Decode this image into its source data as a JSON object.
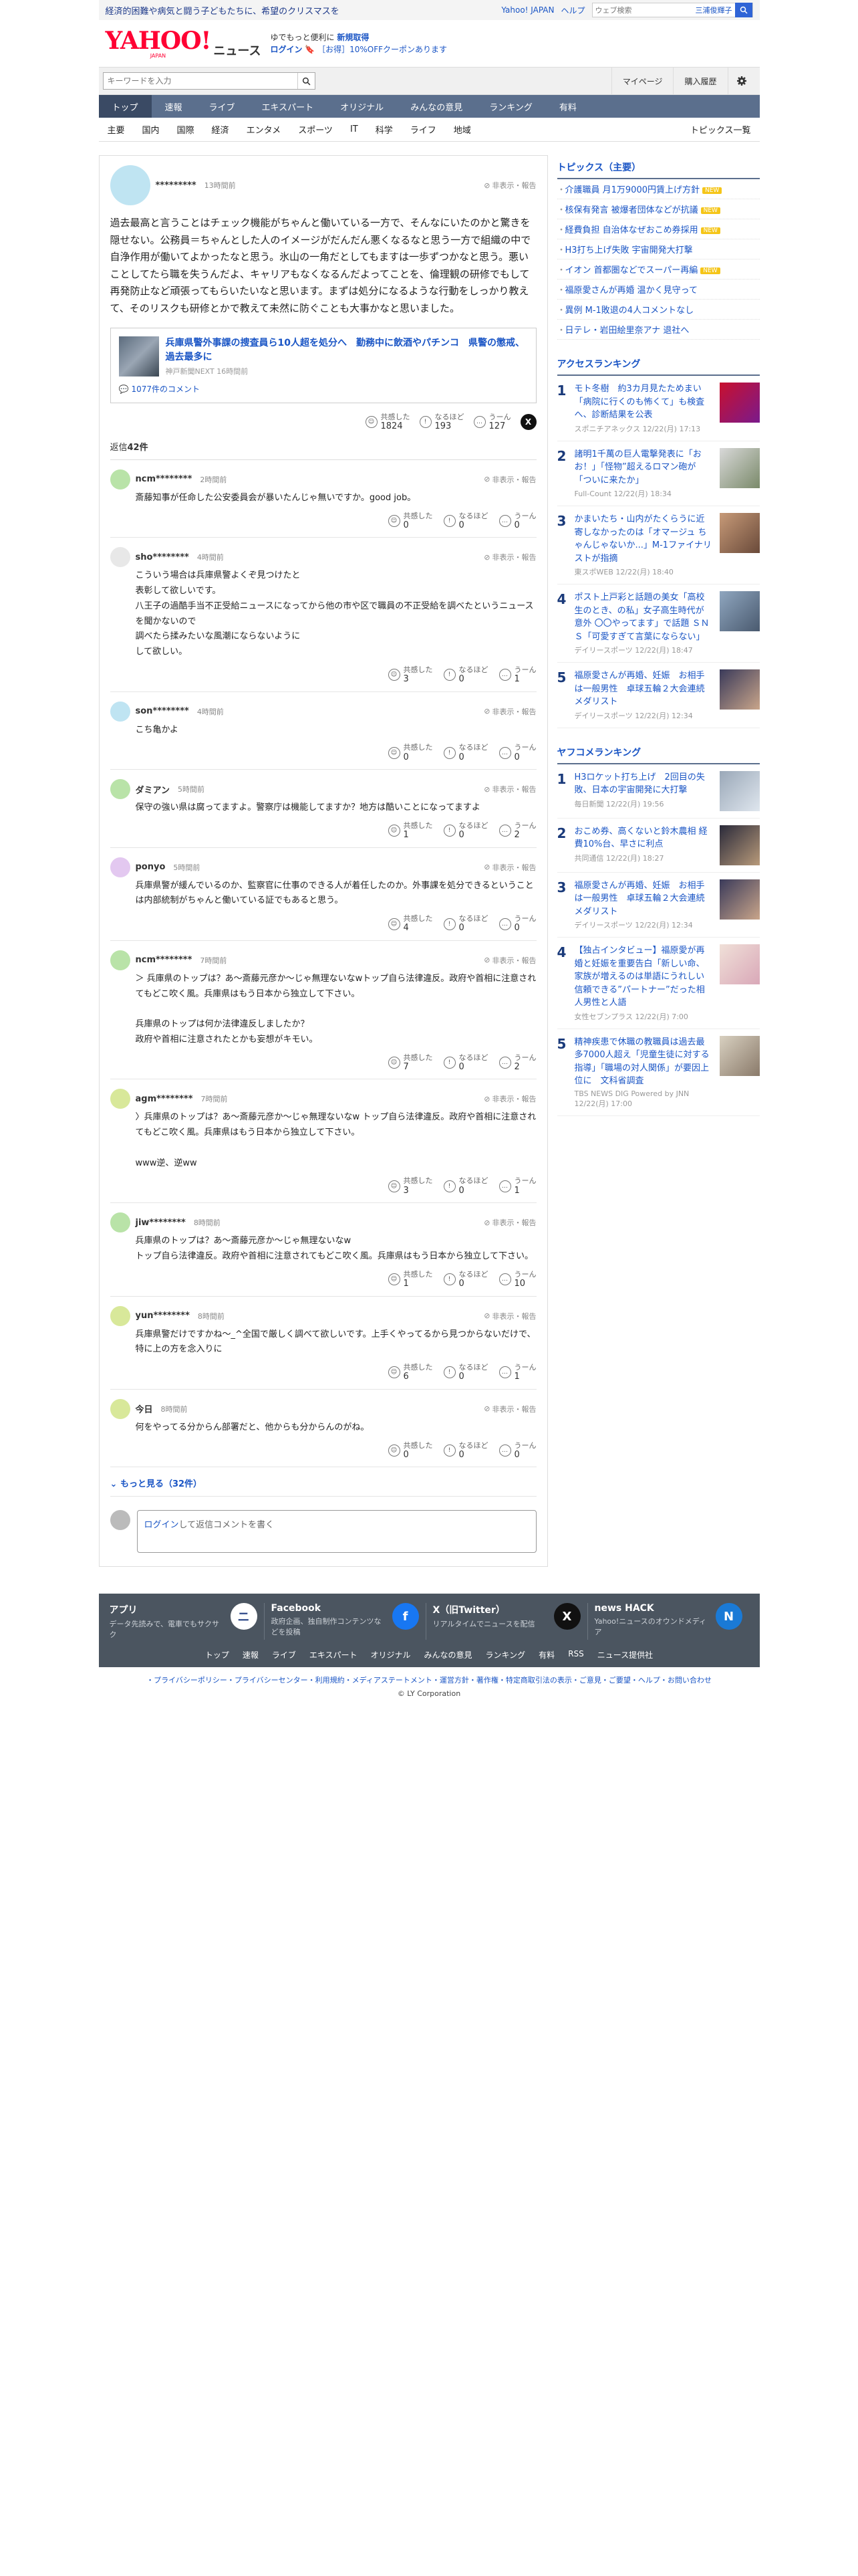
{
  "top_strip": {
    "promo": "経済的困難や病気と闘う子どもたちに、希望のクリスマスを",
    "yahoo_japan": "Yahoo! JAPAN",
    "help": "ヘルプ",
    "search_placeholder": "ウェブ検索",
    "search_hint": "三浦俊輝子"
  },
  "header": {
    "logo_text": "YAHOO!",
    "logo_sub": "JAPAN",
    "logo_news": "ニュース",
    "msg_line1_prefix": "ゆでもっと便利に",
    "msg_line1_link": "新規取得",
    "msg_line2_login": "ログイン",
    "msg_line2_rest": "［お得］10%OFFクーポンあります"
  },
  "search": {
    "placeholder": "キーワードを入力",
    "mypage": "マイページ",
    "history": "購入履歴"
  },
  "nav_main": [
    "トップ",
    "速報",
    "ライブ",
    "エキスパート",
    "オリジナル",
    "みんなの意見",
    "ランキング",
    "有料"
  ],
  "nav_sub": [
    "主要",
    "国内",
    "国際",
    "経済",
    "エンタメ",
    "スポーツ",
    "IT",
    "科学",
    "ライフ",
    "地域"
  ],
  "nav_sub_right": "トピックス一覧",
  "root_comment": {
    "user": "*********",
    "time": "13時間前",
    "report": "非表示・報告",
    "body": "過去最高と言うことはチェック機能がちゃんと働いている一方で、そんなにいたのかと驚きを隠せない。公務員＝ちゃんとした人のイメージがだんだん悪くなるなと思う一方で組織の中で自浄作用が働いてよかったなと思う。氷山の一角だとしてもますは一歩ずつかなと思う。悪いことしてたら職を失うんだよ、キャリアもなくなるんだよってことを、倫理観の研修でもして再発防止など頑張ってもらいたいなと思います。まずは処分になるような行動をしっかり教えて、そのリスクも研修とかで教えて未然に防ぐことも大事かなと思いました。",
    "article": {
      "title": "兵庫県警外事課の捜査員ら10人超を処分へ　勤務中に飲酒やパチンコ　県警の懲戒、過去最多に",
      "meta": "神戸新聞NEXT 16時間前",
      "comments": "1077件のコメント"
    },
    "reactions": {
      "l1": "共感した",
      "v1": "1824",
      "l2": "なるほど",
      "v2": "193",
      "l3": "うーん",
      "v3": "127"
    }
  },
  "replies_label": "返信",
  "replies_count": "42件",
  "replies": [
    {
      "user": "ncm********",
      "time": "2時間前",
      "body": "斎藤知事が任命した公安委員会が暴いたんじゃ無いですか。good job。",
      "r1": "0",
      "r2": "0",
      "r3": "0"
    },
    {
      "user": "sho********",
      "time": "4時間前",
      "body": "こういう場合は兵庫県警よくぞ見つけたと\n表彰して欲しいです。\n八王子の過酷手当不正受給ニュースになってから他の市や区で職員の不正受給を調べたというニュースを聞かないので\n調べたら揉みたいな風潮にならないように\nして欲しい。",
      "r1": "3",
      "r2": "0",
      "r3": "1"
    },
    {
      "user": "son********",
      "time": "4時間前",
      "body": "こち亀かよ",
      "r1": "0",
      "r2": "0",
      "r3": "0"
    },
    {
      "user": "ダミアン",
      "time": "5時間前",
      "body": "保守の強い県は腐ってますよ。警察庁は機能してますか？地方は酷いことになってますよ",
      "r1": "1",
      "r2": "0",
      "r3": "2"
    },
    {
      "user": "ponyo",
      "time": "5時間前",
      "body": "兵庫県警が緩んでいるのか、監察官に仕事のできる人が着任したのか。外事課を処分できるということは内部統制がちゃんと働いている証でもあると思う。",
      "r1": "4",
      "r2": "0",
      "r3": "0"
    },
    {
      "user": "ncm********",
      "time": "7時間前",
      "body": "＞ 兵庫県のトップは？あ〜斎藤元彦か〜じゃ無理ないなwトップ自ら法律違反。政府や首相に注意されてもどこ吹く風。兵庫県はもう日本から独立して下さい。\n\n兵庫県のトップは何か法律違反しましたか？\n政府や首相に注意されたとかも妄想がキモい。",
      "r1": "7",
      "r2": "0",
      "r3": "2"
    },
    {
      "user": "agm********",
      "time": "7時間前",
      "body": "〉兵庫県のトップは？あ〜斎藤元彦か〜じゃ無理ないなw トップ自ら法律違反。政府や首相に注意されてもどこ吹く風。兵庫県はもう日本から独立して下さい。\n\nwww逆、逆ww",
      "r1": "3",
      "r2": "0",
      "r3": "1"
    },
    {
      "user": "jiw********",
      "time": "8時間前",
      "body": "兵庫県のトップは？あ〜斎藤元彦か〜じゃ無理ないなw\nトップ自ら法律違反。政府や首相に注意されてもどこ吹く風。兵庫県はもう日本から独立して下さい。",
      "r1": "1",
      "r2": "0",
      "r3": "10"
    },
    {
      "user": "yun********",
      "time": "8時間前",
      "body": "兵庫県警だけですかね〜_^全国で厳しく調べて欲しいです。上手くやってるから見つからないだけで、特に上の方を念入りに",
      "r1": "6",
      "r2": "0",
      "r3": "1"
    },
    {
      "user": "今日",
      "time": "8時間前",
      "body": "何をやってる分からん部署だと、他からも分からんのがね。",
      "r1": "0",
      "r2": "0",
      "r3": "0"
    }
  ],
  "more_label": "もっと見る",
  "more_count": "（32件）",
  "reply_form": {
    "login": "ログイン",
    "rest": "して返信コメントを書く"
  },
  "sidebar": {
    "topics_title": "トピックス（主要）",
    "topics": [
      {
        "text": "介護職員 月1万9000円賃上げ方針",
        "new": true
      },
      {
        "text": "核保有発言 被爆者団体などが抗議",
        "new": true
      },
      {
        "text": "経費負担 自治体なぜおこめ券採用",
        "new": true
      },
      {
        "text": "H3打ち上げ失敗 宇宙開発大打撃",
        "new": false
      },
      {
        "text": "イオン 首都圏などでスーパー再編",
        "new": true
      },
      {
        "text": "福原愛さんが再婚 温かく見守って",
        "new": false
      },
      {
        "text": "異例 M-1敗退の4人コメントなし",
        "new": false
      },
      {
        "text": "日テレ・岩田絵里奈アナ 退社へ",
        "new": false
      }
    ],
    "new_label": "NEW",
    "access_title": "アクセスランキング",
    "access": [
      {
        "t": "モト冬樹　約3カ月見たためまい「病院に行くのも怖くて」も検査へ、診断結果を公表",
        "s": "スポニチアネックス 12/22(月) 17:13"
      },
      {
        "t": "諸明1千萬の巨人電撃発表に「お お！」「怪物”超えるロマン砲が「ついに来たか」",
        "s": "Full-Count 12/22(月) 18:34"
      },
      {
        "t": "かまいたち・山内がたくらうに近 寄しなかったのは「オマージュ ちゃんじゃないか...」M-1ファイナリストが指摘",
        "s": "東スポWEB 12/22(月) 18:40"
      },
      {
        "t": "ポスト上戸彩と話題の美女「高校 生のとき、の私」女子高生時代が意外 〇〇やってます」で話題 ＳＮＳ「可愛すぎて言葉にならない」",
        "s": "デイリースポーツ 12/22(月) 18:47"
      },
      {
        "t": "福原愛さんが再婚、妊娠　お相手は一般男性　卓球五輪２大会連続メダリスト",
        "s": "デイリースポーツ 12/22(月) 12:34"
      }
    ],
    "yafuko_title": "ヤフコメランキング",
    "yafuko": [
      {
        "t": "H3ロケット打ち上げ　2回目の失敗、日本の宇宙開発に大打撃",
        "s": "毎日新聞 12/22(月) 19:56"
      },
      {
        "t": "おこめ券、高くないと鈴木農相 経費10%台、早さに利点",
        "s": "共同通信 12/22(月) 18:27"
      },
      {
        "t": "福原愛さんが再婚、妊娠　お相手は一般男性　卓球五輪２大会連続メダリスト",
        "s": "デイリースポーツ 12/22(月) 12:34"
      },
      {
        "t": "【独占インタビュー】福原愛が再婚と妊娠を重要告白「新しい命、家族が増えるのは単語にうれしい信頼できる”パートナー”だった相人男性と人語",
        "s": "女性セブンプラス 12/22(月) 7:00"
      },
      {
        "t": "精神疾患で休職の教職員は過去最多7000人超え「児童生徒に対する指導」「職場の対人関係」が要因上位に　文科省調査",
        "s": "TBS NEWS DIG Powered by JNN 12/22(月) 17:00"
      }
    ]
  },
  "footer": {
    "apps": [
      {
        "title": "アプリ",
        "desc": "データ先読みで、電車でもサクサク"
      },
      {
        "title": "Facebook",
        "desc": "政府企画、独自制作コンテンツなどを投稿"
      },
      {
        "title": "X（旧Twitter）",
        "desc": "リアルタイムでニュースを配信"
      },
      {
        "title": "news HACK",
        "desc": "Yahoo!ニュースのオウンドメディア"
      }
    ],
    "links": [
      "トップ",
      "速報",
      "ライブ",
      "エキスパート",
      "オリジナル",
      "みんなの意見",
      "ランキング",
      "有料",
      "RSS",
      "ニュース提供社"
    ],
    "legal": "・プライバシーポリシー・プライバシーセンター・利用規約・メディアステートメント・運営方針・著作権・特定商取引法の表示・ご意見・ご要望・ヘルプ・お問い合わせ",
    "copy": "© LY Corporation"
  },
  "colors": {
    "accent": "#1a55c5",
    "nav_bg": "#5b6f8d",
    "nav_active": "#3a4a64",
    "brand": "#ff0033",
    "footer_bg": "#4b5560"
  }
}
